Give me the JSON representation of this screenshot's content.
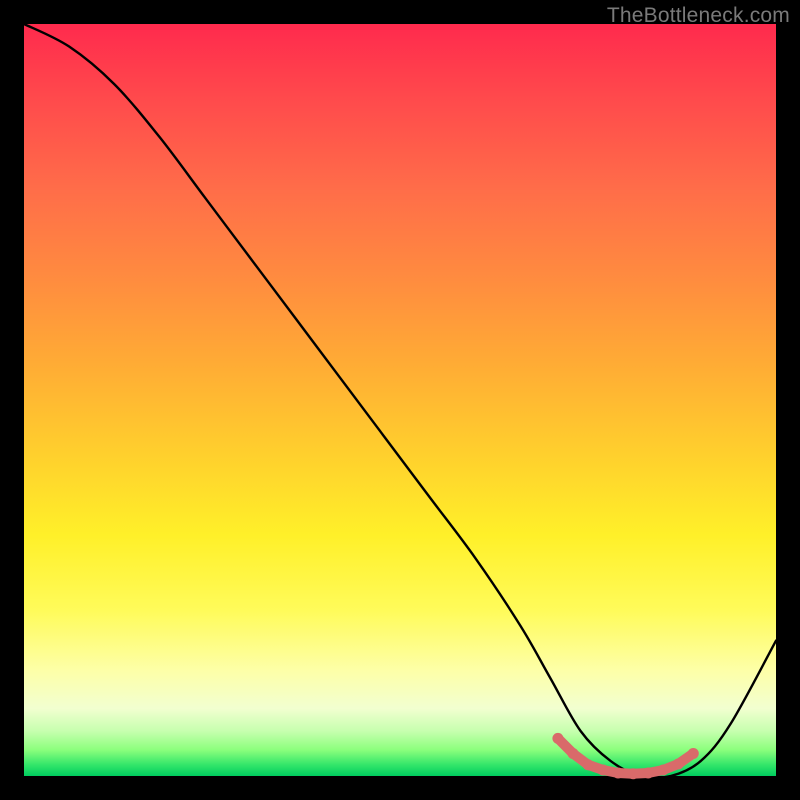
{
  "watermark": "TheBottleneck.com",
  "chart_data": {
    "type": "line",
    "title": "",
    "xlabel": "",
    "ylabel": "",
    "xlim": [
      0,
      100
    ],
    "ylim": [
      0,
      100
    ],
    "series": [
      {
        "name": "bottleneck-curve",
        "x": [
          0,
          6,
          12,
          18,
          24,
          30,
          36,
          42,
          48,
          54,
          60,
          66,
          70,
          74,
          78,
          82,
          86,
          90,
          94,
          100
        ],
        "values": [
          100,
          97,
          92,
          85,
          77,
          69,
          61,
          53,
          45,
          37,
          29,
          20,
          13,
          6,
          2,
          0,
          0,
          2,
          7,
          18
        ]
      },
      {
        "name": "optimal-region-markers",
        "x": [
          71,
          73,
          75,
          77,
          79,
          81,
          83,
          85,
          87,
          89
        ],
        "values": [
          5,
          3,
          1.5,
          0.8,
          0.4,
          0.3,
          0.4,
          0.8,
          1.6,
          3
        ]
      }
    ],
    "marker_color": "#d96a6a",
    "curve_color": "#000000"
  }
}
